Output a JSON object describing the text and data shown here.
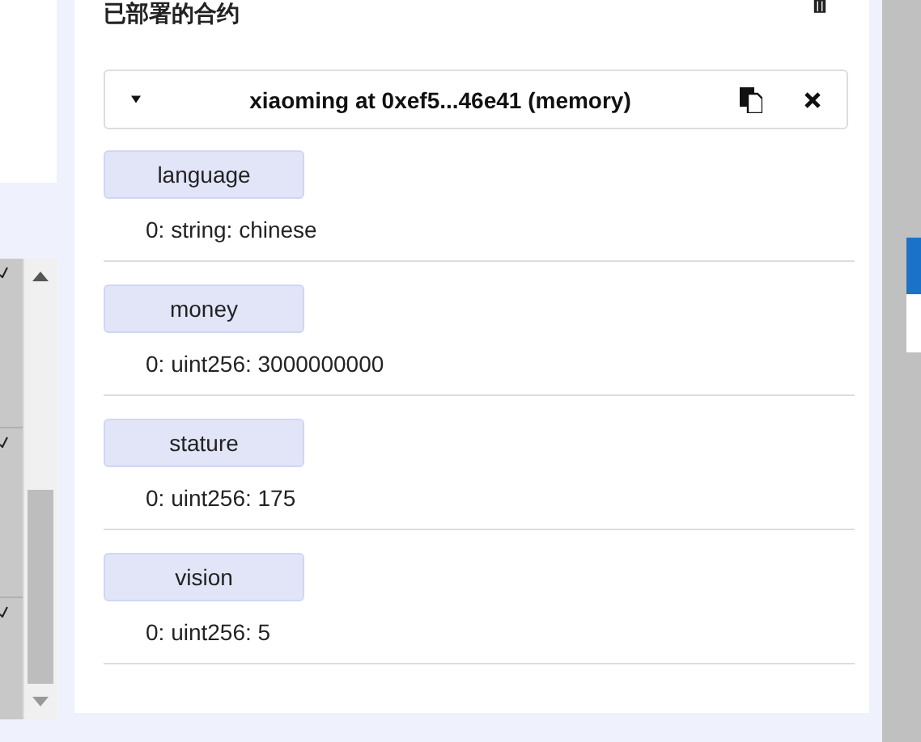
{
  "panel": {
    "title": "已部署的合约"
  },
  "contract": {
    "label": "xiaoming at 0xef5...46e41 (memory)",
    "expanded": true
  },
  "functions": [
    {
      "name": "language",
      "output": "0: string: chinese"
    },
    {
      "name": "money",
      "output": "0: uint256: 3000000000"
    },
    {
      "name": "stature",
      "output": "0: uint256: 175"
    },
    {
      "name": "vision",
      "output": "0: uint256: 5"
    }
  ]
}
